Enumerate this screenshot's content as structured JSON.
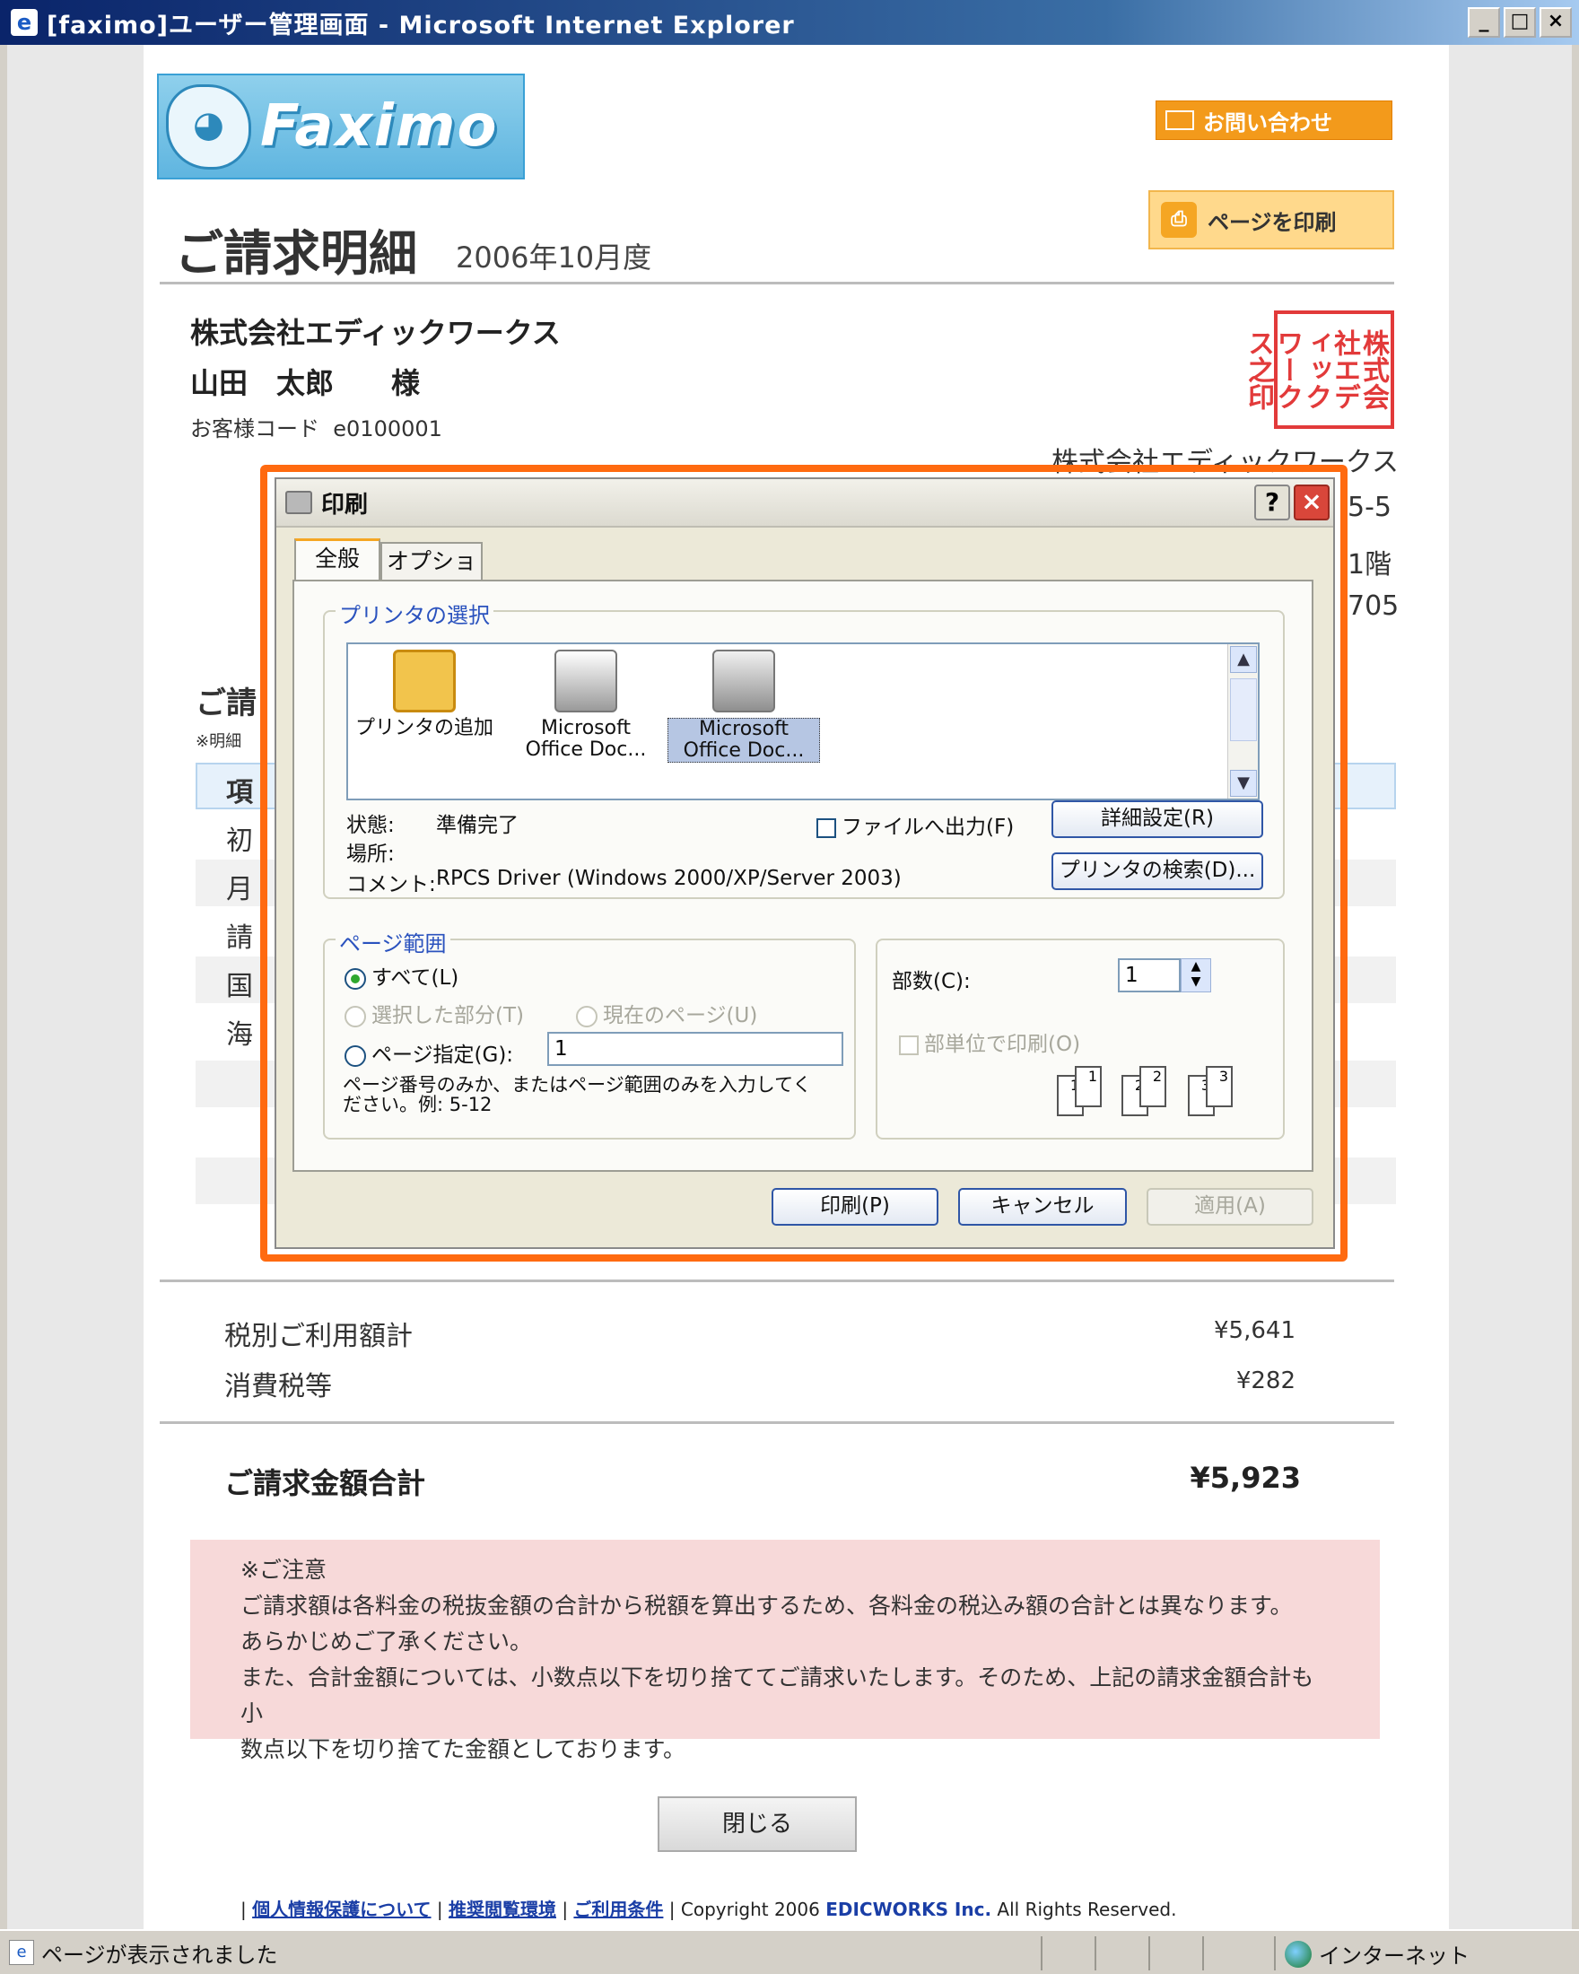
{
  "window": {
    "title": "[faximo]ユーザー管理画面 - Microsoft Internet Explorer",
    "minimize": "_",
    "maximize": "□",
    "close": "×"
  },
  "header": {
    "logo_text": "Faximo",
    "contact_label": "お問い合わせ",
    "print_page_label": "ページを印刷",
    "heading": "ご請求明細",
    "period": "2006年10月度"
  },
  "customer": {
    "company": "株式会社エディックワークス",
    "name": "山田　太郎　　様",
    "code_label": "お客様コード",
    "code": "e0100001"
  },
  "issuer": {
    "seal_text": "株式会社エディックワークス之印",
    "name": "株式会社エディックワークス",
    "addr_fragment_1": "5-5",
    "addr_fragment_2": "1階",
    "addr_fragment_3": "705"
  },
  "background_rows": {
    "section_fragment": "ご請",
    "note_fragment": "※明細",
    "row1": "項",
    "row2": "初",
    "row3": "月",
    "row4": "請",
    "row5": "国",
    "row6": "海"
  },
  "dialog": {
    "title": "印刷",
    "help": "?",
    "close": "×",
    "tabs": [
      "全般",
      "オプション"
    ],
    "printer_group_label": "プリンタの選択",
    "printers": [
      {
        "label": "プリンタの追加",
        "icon": "add-printer-icon"
      },
      {
        "label": "Microsoft Office Doc...",
        "icon": "printer-icon"
      },
      {
        "label": "Microsoft Office Doc...",
        "icon": "default-printer-icon"
      }
    ],
    "status_label": "状態:",
    "status_value": "準備完了",
    "location_label": "場所:",
    "comment_label": "コメント:",
    "comment_value": "RPCS Driver (Windows 2000/XP/Server 2003)",
    "print_to_file": "ファイルへ出力(F)",
    "advanced_button": "詳細設定(R)",
    "find_printer_button": "プリンタの検索(D)...",
    "page_range_label": "ページ範囲",
    "range_all": "すべて(L)",
    "range_selection": "選択した部分(T)",
    "range_current": "現在のページ(U)",
    "range_pages": "ページ指定(G):",
    "range_pages_value": "1",
    "range_hint": "ページ番号のみか、またはページ範囲のみを入力してください。例: 5-12",
    "copies_label": "部数(C):",
    "copies_value": "1",
    "collate_label": "部単位で印刷(O)",
    "collate_numbers": [
      "1",
      "1",
      "2",
      "2",
      "3",
      "3"
    ],
    "print_button": "印刷(P)",
    "cancel_button": "キャンセル",
    "apply_button": "適用(A)"
  },
  "summary": {
    "subtotal_label": "税別ご利用額計",
    "subtotal_value": "¥5,641",
    "tax_label": "消費税等",
    "tax_value": "¥282",
    "total_label": "ご請求金額合計",
    "total_value": "¥5,923"
  },
  "notice": {
    "title": "※ご注意",
    "line1": "ご請求額は各料金の税抜金額の合計から税額を算出するため、各料金の税込み額の合計とは異なります。",
    "line2": "あらかじめご了承ください。",
    "line3": "また、合計金額については、小数点以下を切り捨ててご請求いたします。そのため、上記の請求金額合計も小",
    "line4": "数点以下を切り捨てた金額としております。"
  },
  "close_button": "閉じる",
  "footer": {
    "link_privacy": "個人情報保護について",
    "link_browser": "推奨閲覧環境",
    "link_terms": "ご利用条件",
    "copyright": "Copyright 2006",
    "company": "EDICWORKS Inc.",
    "rights": "All Rights Reserved."
  },
  "statusbar": {
    "message": "ページが表示されました",
    "zone": "インターネット"
  }
}
